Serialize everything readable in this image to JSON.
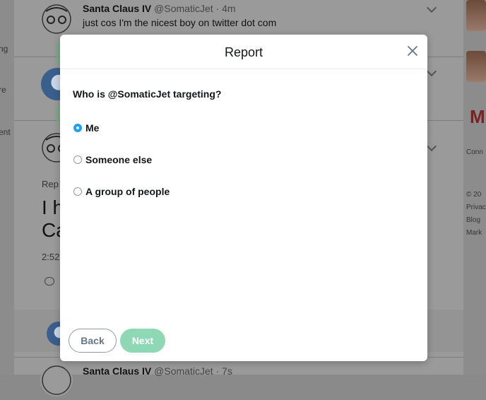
{
  "background": {
    "left_fragments": [
      "ng",
      "re",
      "ent"
    ],
    "tweet1": {
      "name": "Santa Claus IV",
      "handle": "@SomaticJet",
      "time": "· 4m",
      "text": "just cos I'm the nicest boy on twitter dot com"
    },
    "tweet_partial": {
      "reply_prefix": "Rep",
      "big_line1": "I h",
      "big_line2": "Ca",
      "time_fragment": "2:52"
    },
    "tweet_bottom": {
      "name": "Santa Claus IV",
      "handle": "@SomaticJet",
      "time": "· 7s"
    },
    "right_fragments": [
      "Conn",
      "© 20",
      "Privac",
      "Blog",
      "Mark"
    ]
  },
  "modal": {
    "title": "Report",
    "close_icon": "close-icon",
    "question": "Who is @SomaticJet targeting?",
    "options": [
      {
        "label": "Me",
        "selected": true
      },
      {
        "label": "Someone else",
        "selected": false
      },
      {
        "label": "A group of people",
        "selected": false
      }
    ],
    "back_label": "Back",
    "next_label": "Next"
  },
  "colors": {
    "accent": "#1da1f2",
    "next_button": "#8fd8b6",
    "overlay": "#8a8a8a"
  }
}
